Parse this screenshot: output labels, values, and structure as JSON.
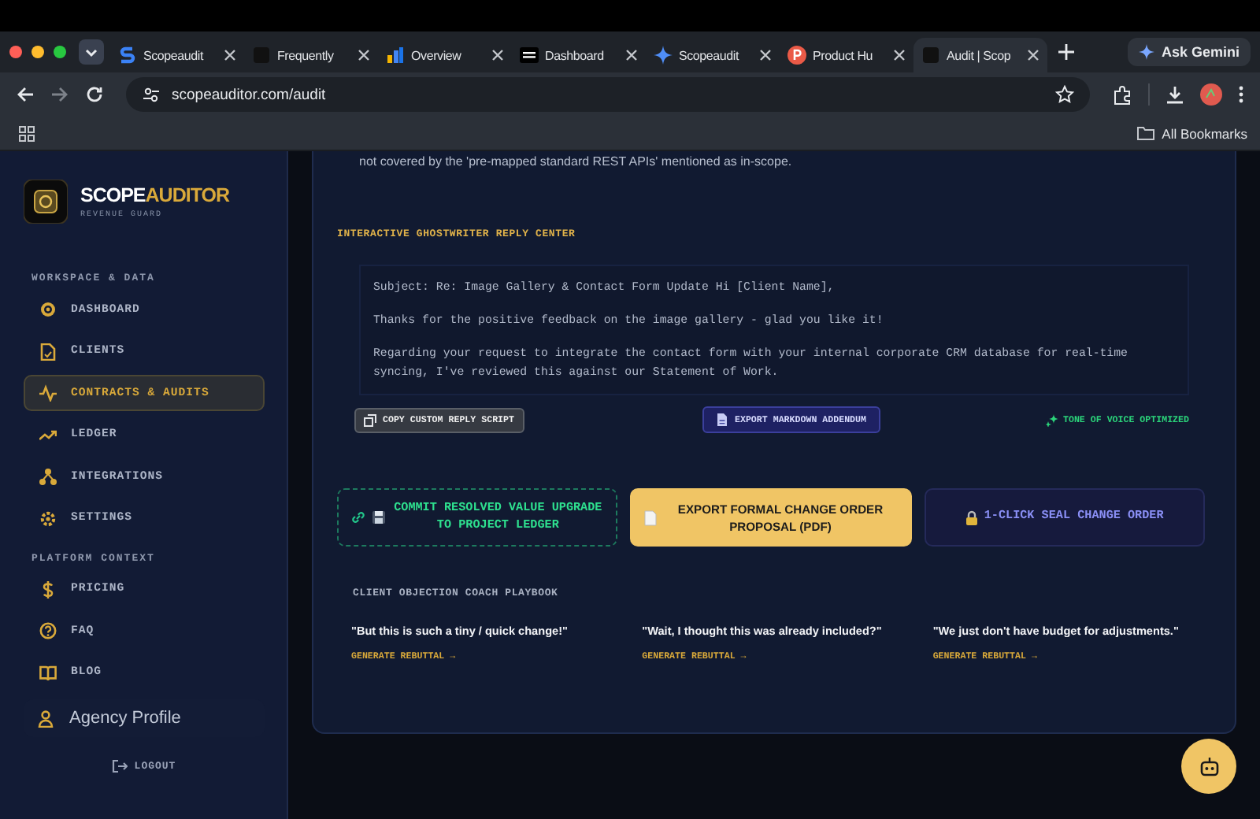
{
  "browser": {
    "tabs": [
      {
        "label": "Scopeaudit",
        "kind": "s-logo",
        "selected": false
      },
      {
        "label": "Frequently",
        "kind": "square",
        "selected": false
      },
      {
        "label": "Overview",
        "kind": "bars",
        "selected": false
      },
      {
        "label": "Dashboard",
        "kind": "dev",
        "selected": false
      },
      {
        "label": "Scopeaudit",
        "kind": "sparkle",
        "selected": false
      },
      {
        "label": "Product Hu",
        "kind": "p-circle",
        "selected": false
      },
      {
        "label": "Audit | Scop",
        "kind": "square",
        "selected": true
      }
    ],
    "gemini_button": "Ask Gemini",
    "url": "scopeauditor.com/audit",
    "bookmarks": "All Bookmarks"
  },
  "sidebar": {
    "brand": {
      "first": "SCOPE",
      "second": "AUDITOR",
      "tagline": "REVENUE GUARD"
    },
    "sections": [
      {
        "title": "WORKSPACE & DATA",
        "items": [
          {
            "label": "DASHBOARD",
            "kind": "target",
            "selected": false
          },
          {
            "label": "CLIENTS",
            "kind": "file",
            "selected": false
          },
          {
            "label": "CONTRACTS & AUDITS",
            "kind": "pulse",
            "selected": true
          },
          {
            "label": "LEDGER",
            "kind": "trend",
            "selected": false
          },
          {
            "label": "INTEGRATIONS",
            "kind": "nodes",
            "selected": false
          },
          {
            "label": "SETTINGS",
            "kind": "gear",
            "selected": false
          }
        ]
      },
      {
        "title": "PLATFORM CONTEXT",
        "items": [
          {
            "label": "PRICING",
            "kind": "dollar",
            "selected": false
          },
          {
            "label": "FAQ",
            "kind": "help",
            "selected": false
          },
          {
            "label": "BLOG",
            "kind": "book",
            "selected": false
          }
        ]
      }
    ],
    "profile": "Agency Profile",
    "logout": "LOGOUT"
  },
  "main": {
    "intro_tail": "not covered by the 'pre-mapped standard REST APIs' mentioned as in-scope.",
    "reply_center": {
      "title": "INTERACTIVE GHOSTWRITER REPLY CENTER",
      "paragraphs": [
        "Subject: Re: Image Gallery & Contact Form Update Hi [Client Name],",
        "Thanks for the positive feedback on the image gallery - glad you like it!",
        "Regarding your request to integrate the contact form with your internal corporate CRM database for real-time syncing, I've reviewed this against our Statement of Work."
      ],
      "copy_button": "COPY CUSTOM REPLY SCRIPT",
      "export_button": "EXPORT MARKDOWN ADDENDUM",
      "tone_status": "TONE OF VOICE OPTIMIZED"
    },
    "actions": [
      {
        "kind": "commit",
        "label": "COMMIT RESOLVED VALUE UPGRADE TO PROJECT LEDGER"
      },
      {
        "kind": "export",
        "label": "EXPORT FORMAL CHANGE ORDER PROPOSAL (PDF)"
      },
      {
        "kind": "seal",
        "label": "1-CLICK SEAL CHANGE ORDER"
      }
    ],
    "playbook": {
      "title": "CLIENT OBJECTION COACH PLAYBOOK",
      "objections": [
        {
          "quote": "\"But this is such a tiny / quick change!\"",
          "action": "GENERATE REBUTTAL →"
        },
        {
          "quote": "\"Wait, I thought this was already included?\"",
          "action": "GENERATE REBUTTAL →"
        },
        {
          "quote": "\"We just don't have budget for adjustments.\"",
          "action": "GENERATE REBUTTAL →"
        }
      ]
    }
  }
}
